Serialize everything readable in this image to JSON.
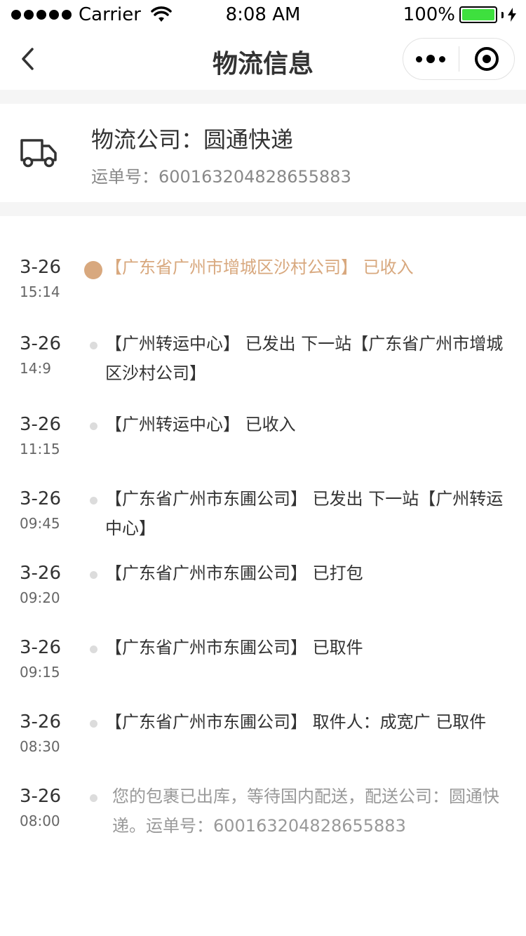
{
  "status_bar": {
    "carrier": "Carrier",
    "time": "8:08 AM",
    "battery": "100%",
    "battery_color": "#3ee03e"
  },
  "nav": {
    "title": "物流信息",
    "back_icon": "chevron-left-icon",
    "more_icon": "more-dots-icon",
    "close_icon": "target-icon"
  },
  "shipment": {
    "company": "物流公司：圆通快递",
    "waybill": "运单号：600163204828655883",
    "icon": "truck-icon"
  },
  "colors": {
    "accent": "#d8a87e",
    "dot": "#dcdcdc",
    "divider": "#f5f5f5"
  },
  "timeline": [
    {
      "date": "3-26",
      "time": "15:14",
      "text": "【广东省广州市增城区沙村公司】  已收入",
      "state": "active"
    },
    {
      "date": "3-26",
      "time": "14:9",
      "text": "【广州转运中心】  已发出  下一站【广东省广州市增城区沙村公司】",
      "state": "normal"
    },
    {
      "date": "3-26",
      "time": "11:15",
      "text": "【广州转运中心】  已收入",
      "state": "normal"
    },
    {
      "date": "3-26",
      "time": "09:45",
      "text": "【广东省广州市东圃公司】  已发出  下一站【广州转运中心】",
      "state": "normal"
    },
    {
      "date": "3-26",
      "time": "09:20",
      "text": "【广东省广州市东圃公司】  已打包",
      "state": "normal"
    },
    {
      "date": "3-26",
      "time": "09:15",
      "text": "【广东省广州市东圃公司】  已取件",
      "state": "normal"
    },
    {
      "date": "3-26",
      "time": "08:30",
      "text": "【广东省广州市东圃公司】  取件人：成宽广 已取件",
      "state": "normal"
    },
    {
      "date": "3-26",
      "time": "08:00",
      "text": "您的包裹已出库，等待国内配送，配送公司：圆通快递。运单号：600163204828655883",
      "state": "grey"
    }
  ]
}
